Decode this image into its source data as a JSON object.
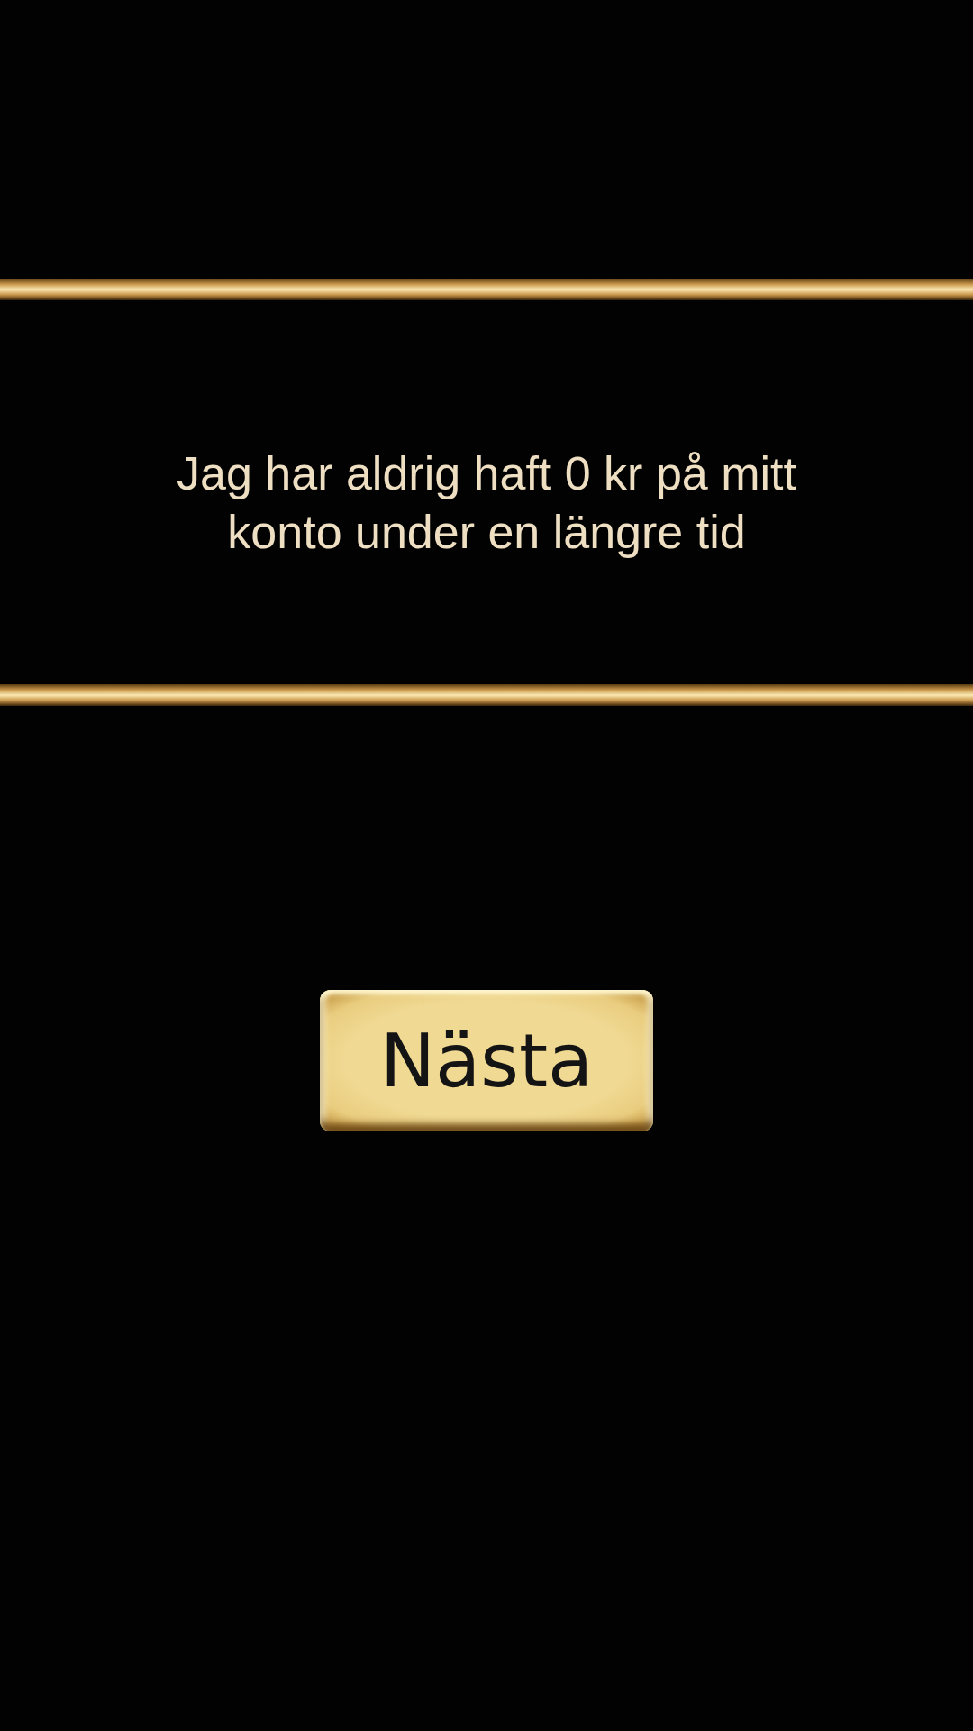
{
  "statement": "Jag har aldrig haft 0 kr på mitt konto under en längre tid",
  "buttons": [
    {
      "label": "Nästa"
    }
  ]
}
